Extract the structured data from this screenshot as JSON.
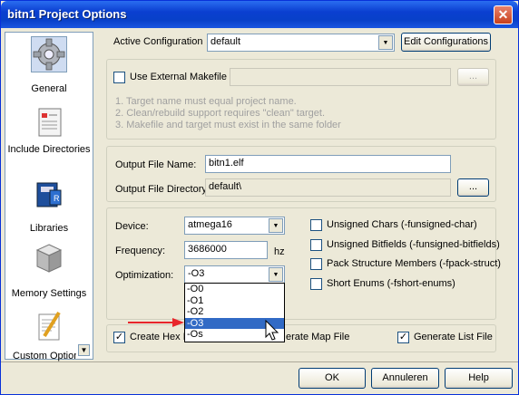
{
  "window": {
    "title": "bitn1 Project Options"
  },
  "sidebar": {
    "items": [
      {
        "label": "General",
        "icon": "gear-icon",
        "selected": true
      },
      {
        "label": "Include Directories",
        "icon": "include-directories-icon"
      },
      {
        "label": "Libraries",
        "icon": "libraries-icon"
      },
      {
        "label": "Memory Settings",
        "icon": "memory-settings-icon"
      },
      {
        "label": "Custom Options",
        "icon": "custom-options-icon"
      }
    ]
  },
  "config": {
    "label": "Active Configuration",
    "value": "default",
    "edit_button": "Edit Configurations"
  },
  "makefile": {
    "checkbox_label": "Use External Makefile",
    "checked": false,
    "browse_label": "...",
    "notes": [
      "1. Target name must equal project name.",
      "2. Clean/rebuild support requires \"clean\" target.",
      "3. Makefile and target must exist in the same folder"
    ]
  },
  "output": {
    "file_name_label": "Output File Name:",
    "file_name_value": "bitn1.elf",
    "dir_label": "Output File Directory:",
    "dir_value": "default\\",
    "browse_label": "..."
  },
  "device": {
    "device_label": "Device:",
    "device_value": "atmega16",
    "frequency_label": "Frequency:",
    "frequency_value": "3686000",
    "frequency_unit": "hz",
    "optimization_label": "Optimization:",
    "optimization_value": "-O3",
    "optimization_options": [
      "-O0",
      "-O1",
      "-O2",
      "-O3",
      "-Os"
    ],
    "options": [
      {
        "label": "Unsigned Chars (-funsigned-char)",
        "checked": false
      },
      {
        "label": "Unsigned Bitfields (-funsigned-bitfields)",
        "checked": false
      },
      {
        "label": "Pack Structure Members (-fpack-struct)",
        "checked": false
      },
      {
        "label": "Short Enums (-fshort-enums)",
        "checked": false
      }
    ]
  },
  "files": {
    "hex_label": "Create Hex F",
    "hex_checked": true,
    "map_label": "erate Map File",
    "list_label": "Generate List File",
    "list_checked": true
  },
  "buttons": {
    "ok": "OK",
    "cancel": "Annuleren",
    "help": "Help"
  },
  "colors": {
    "accent": "#316ac5",
    "arrow": "#e8262b",
    "titlebar": "#0a3fd0"
  }
}
